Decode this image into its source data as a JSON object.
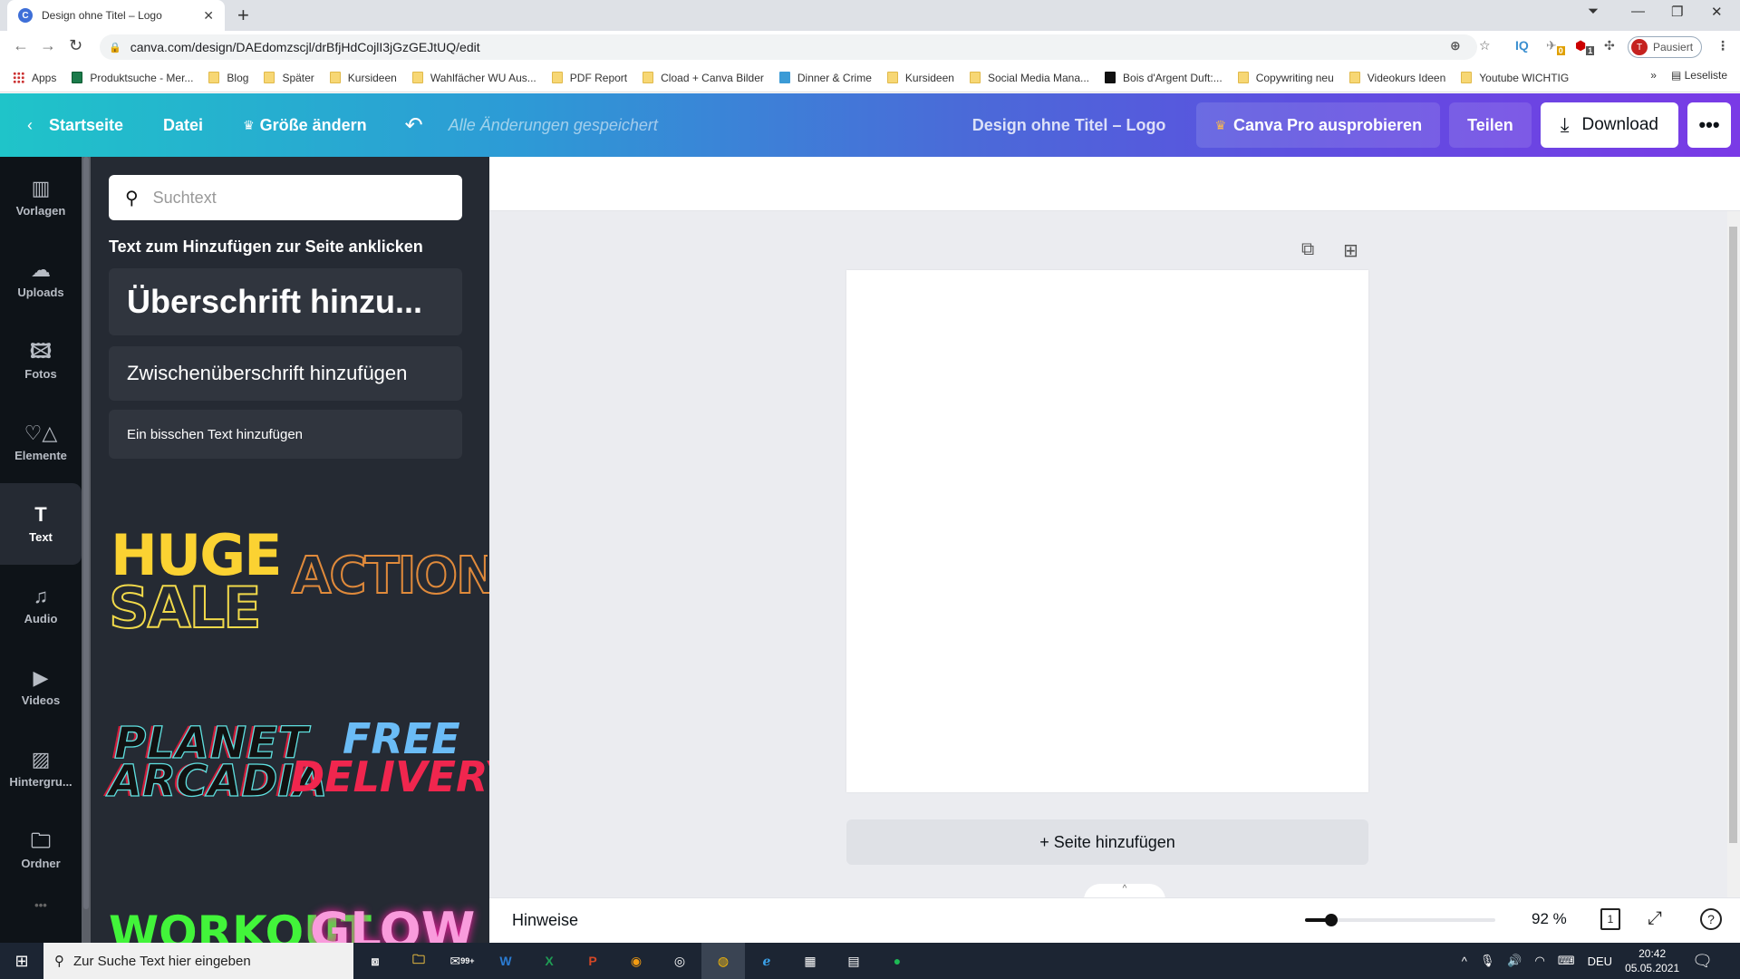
{
  "browser": {
    "tab_title": "Design ohne Titel – Logo",
    "tab_favicon": "C",
    "url": "canva.com/design/DAEdomzscjl/drBfjHdCojlI3jGzGEJtUQ/edit",
    "profile_initial": "T",
    "profile_status": "Pausiert",
    "ext_iq": "IQ",
    "ext_badge_count": "0",
    "abp_badge": "1",
    "bookmarks": [
      {
        "label": "Apps",
        "icon": "apps"
      },
      {
        "label": "Produktsuche - Mer...",
        "icon": "g"
      },
      {
        "label": "Blog",
        "icon": "folder"
      },
      {
        "label": "Später",
        "icon": "folder"
      },
      {
        "label": "Kursideen",
        "icon": "folder"
      },
      {
        "label": "Wahlfächer WU Aus...",
        "icon": "folder"
      },
      {
        "label": "PDF Report",
        "icon": "folder"
      },
      {
        "label": "Cload + Canva Bilder",
        "icon": "folder"
      },
      {
        "label": "Dinner & Crime",
        "icon": "jd"
      },
      {
        "label": "Kursideen",
        "icon": "folder"
      },
      {
        "label": "Social Media Mana...",
        "icon": "folder"
      },
      {
        "label": "Bois d'Argent Duft:...",
        "icon": "k"
      },
      {
        "label": "Copywriting neu",
        "icon": "folder"
      },
      {
        "label": "Videokurs Ideen",
        "icon": "folder"
      },
      {
        "label": "Youtube WICHTIG",
        "icon": "folder"
      }
    ],
    "bookmarks_overflow": "»",
    "reading_list": "Leseliste"
  },
  "header": {
    "home": "Startseite",
    "file": "Datei",
    "resize": "Größe ändern",
    "saved_status": "Alle Änderungen gespeichert",
    "doc_title": "Design ohne Titel – Logo",
    "pro": "Canva Pro ausprobieren",
    "share": "Teilen",
    "download": "Download",
    "more": "•••"
  },
  "sidebar": {
    "items": [
      {
        "label": "Vorlagen",
        "icon": "▥"
      },
      {
        "label": "Uploads",
        "icon": "☁"
      },
      {
        "label": "Fotos",
        "icon": "🖾"
      },
      {
        "label": "Elemente",
        "icon": "♡△"
      },
      {
        "label": "Text",
        "icon": "T"
      },
      {
        "label": "Audio",
        "icon": "♫"
      },
      {
        "label": "Videos",
        "icon": "▶"
      },
      {
        "label": "Hintergru...",
        "icon": "▨"
      },
      {
        "label": "Ordner",
        "icon": "🗀"
      }
    ],
    "more": "•••",
    "active_index": 4
  },
  "panel": {
    "search_placeholder": "Suchtext",
    "heading": "Text zum Hinzufügen zur Seite anklicken",
    "add_heading": "Überschrift hinzu...",
    "add_subheading": "Zwischenüberschrift hinzufügen",
    "add_body": "Ein bisschen Text hinzufügen",
    "combos": {
      "huge": "HUGE",
      "sale": "SALE",
      "action": "ACTION",
      "planet": "PLANET",
      "arcadia": "ARCADIA",
      "free": "FREE",
      "delivery": "DELIVERY",
      "workout": "WORKOUT",
      "glow": "GLOW"
    }
  },
  "canvas": {
    "add_page": "+ Seite hinzufügen",
    "expand": "^"
  },
  "footer": {
    "hints": "Hinweise",
    "zoom_percent": 92,
    "zoom_label": "92 %",
    "zoom_slider_fraction": 0.14,
    "page_count": "1"
  },
  "taskbar": {
    "search_placeholder": "Zur Suche Text hier eingeben",
    "mail_badge": "99+",
    "language": "DEU",
    "time": "20:42",
    "date": "05.05.2021"
  }
}
